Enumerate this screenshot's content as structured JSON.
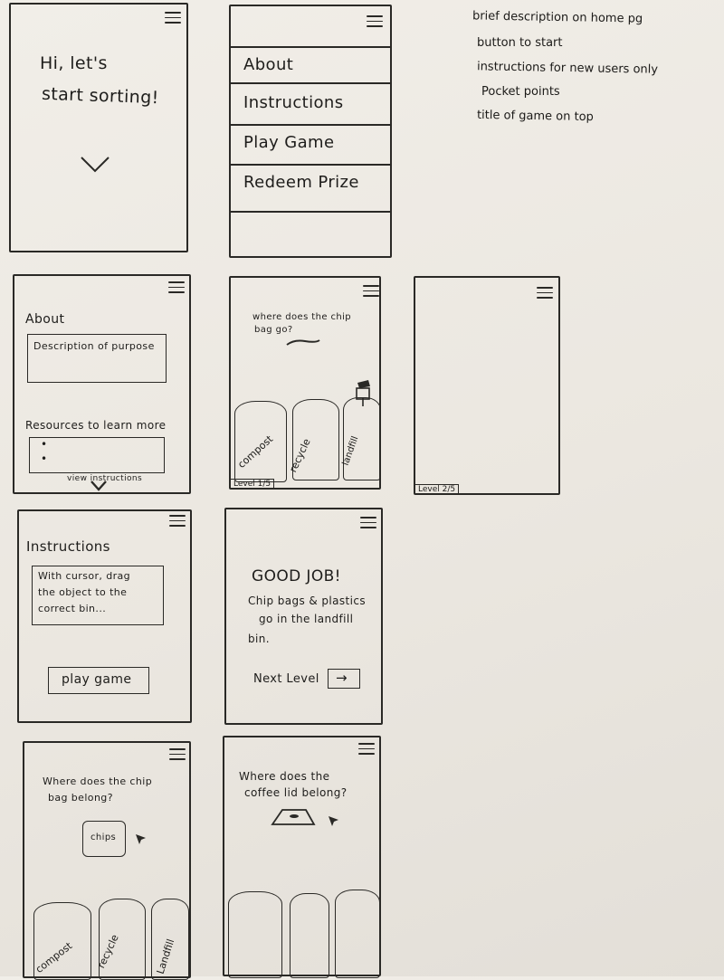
{
  "notes": [
    "brief description on home pg",
    "button to start",
    "instructions for new users only",
    "Pocket points",
    "title of game on top"
  ],
  "home": {
    "greeting_line1": "Hi, let's",
    "greeting_line2": "start sorting!"
  },
  "menu": {
    "items": [
      "About",
      "Instructions",
      "Play Game",
      "Redeem Prize"
    ]
  },
  "about": {
    "title": "About",
    "description": "Description of purpose",
    "resources_label": "Resources to learn more",
    "bullets": [
      "•",
      "•"
    ],
    "view_instructions": "view instructions"
  },
  "game1": {
    "question_line1": "where does the chip",
    "question_line2": "bag go?",
    "bins": [
      "compost",
      "recycle",
      "landfill"
    ],
    "level": "Level 1/5"
  },
  "game2": {
    "level": "Level 2/5"
  },
  "instructions": {
    "title": "Instructions",
    "text_line1": "With cursor, drag",
    "text_line2": "the object to the",
    "text_line3": "correct bin...",
    "play_button": "play game"
  },
  "result": {
    "heading": "GOOD JOB!",
    "line1": "Chip bags & plastics",
    "line2": "go in the landfill",
    "line3": "bin.",
    "next_label": "Next Level",
    "next_arrow": "→"
  },
  "sort1": {
    "question_line1": "Where does the chip",
    "question_line2": "bag belong?",
    "item_label": "chips",
    "bins": [
      "compost",
      "recycle",
      "Landfill"
    ]
  },
  "sort2": {
    "question_line1": "Where does the",
    "question_line2": "coffee lid belong?"
  }
}
